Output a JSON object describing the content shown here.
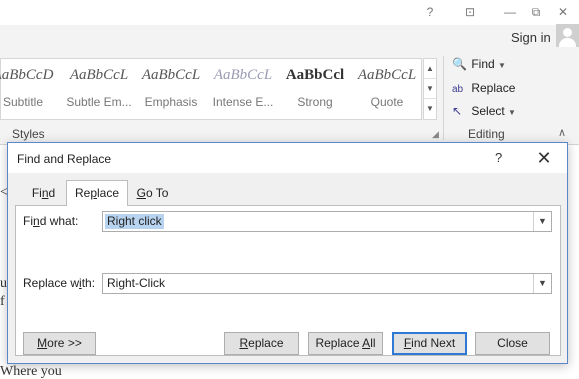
{
  "window": {
    "help": "?",
    "ribbon_display": "⊡",
    "minimize": "—",
    "restore": "⧉",
    "close": "✕",
    "signin": "Sign in"
  },
  "ribbon": {
    "styles_group_label": "Styles",
    "editing_group_label": "Editing",
    "styles": [
      {
        "sample": "AaBbCcD",
        "name": "Subtitle"
      },
      {
        "sample": "AaBbCcL",
        "name": "Subtle Em..."
      },
      {
        "sample": "AaBbCcL",
        "name": "Emphasis"
      },
      {
        "sample": "AaBbCcL",
        "name": "Intense E..."
      },
      {
        "sample": "AaBbCcl",
        "name": "Strong"
      },
      {
        "sample": "AaBbCcL",
        "name": "Quote"
      }
    ],
    "editing": {
      "find": "Find",
      "replace": "Replace",
      "select": "Select"
    }
  },
  "document_peek": [
    "<",
    "ut",
    "f",
    "Where you"
  ],
  "dialog": {
    "title": "Find and Replace",
    "help": "?",
    "close": "✕",
    "tabs": {
      "find_pre": "Fi",
      "find_u": "n",
      "find_post": "d",
      "replace_pre": "Re",
      "replace_u": "p",
      "replace_post": "lace",
      "goto_u": "G",
      "goto_post": "o To"
    },
    "find_label_pre": "Fi",
    "find_label_u": "n",
    "find_label_post": "d what:",
    "find_value": "Right click",
    "replace_label_pre": "Replace w",
    "replace_label_u": "i",
    "replace_label_post": "th:",
    "replace_value": "Right-Click",
    "buttons": {
      "more_u": "M",
      "more_post": "ore >>",
      "replace_u": "R",
      "replace_post": "eplace",
      "replace_all_pre": "Replace ",
      "replace_all_u": "A",
      "replace_all_post": "ll",
      "find_next_u": "F",
      "find_next_post": "ind Next",
      "close": "Close"
    }
  }
}
